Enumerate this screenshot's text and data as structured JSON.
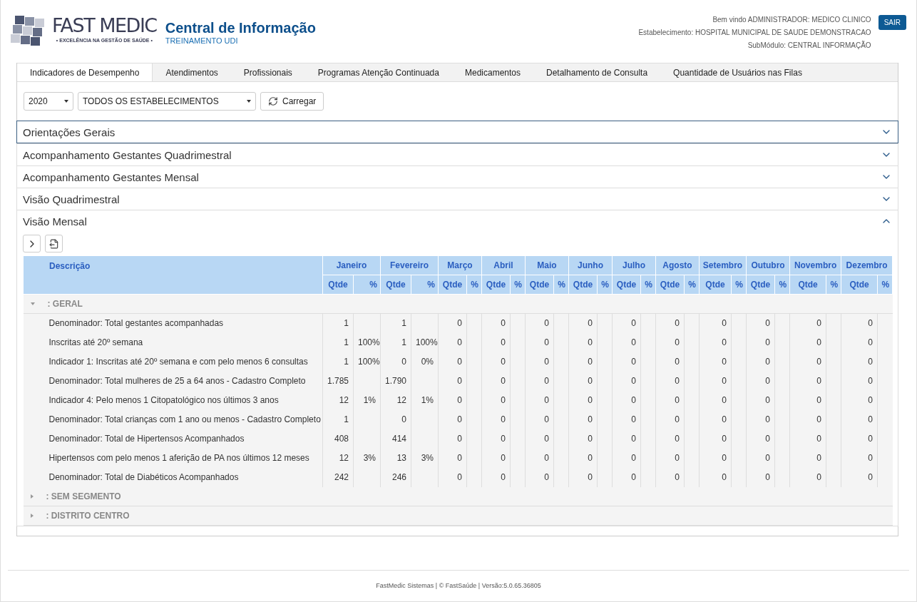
{
  "logo": {
    "brand": "FAST MEDIC",
    "tagline": "• EXCELÊNCIA NA GESTÃO DE SAÚDE •"
  },
  "header": {
    "title": "Central de Informação",
    "subtitle": "TREINAMENTO UDI",
    "user_lines": [
      "Bem vindo ADMINISTRADOR: MEDICO CLINICO",
      "Estabelecimento: HOSPITAL MUNICIPAL DE SAUDE DEMONSTRACAO",
      "SubMódulo: CENTRAL INFORMAÇÃO"
    ],
    "logout": "SAIR"
  },
  "tabs": [
    {
      "label": "Indicadores de Desempenho",
      "selected": true
    },
    {
      "label": "Atendimentos",
      "selected": false
    },
    {
      "label": "Profissionais",
      "selected": false
    },
    {
      "label": "Programas Atenção Continuada",
      "selected": false
    },
    {
      "label": "Medicamentos",
      "selected": false
    },
    {
      "label": "Detalhamento de Consulta",
      "selected": false
    },
    {
      "label": "Quantidade de Usuários nas Filas",
      "selected": false
    }
  ],
  "filters": {
    "year": "2020",
    "establishment": "TODOS OS ESTABELECIMENTOS",
    "load_button": "Carregar"
  },
  "sections": [
    {
      "title": "Orientações Gerais",
      "expanded": false,
      "focused": true
    },
    {
      "title": "Acompanhamento Gestantes Quadrimestral",
      "expanded": false,
      "focused": false
    },
    {
      "title": "Acompanhamento Gestantes Mensal",
      "expanded": false,
      "focused": false
    },
    {
      "title": "Visão Quadrimestral",
      "expanded": false,
      "focused": false
    },
    {
      "title": "Visão Mensal",
      "expanded": true,
      "focused": false
    }
  ],
  "table": {
    "description_header": "Descrição",
    "months": [
      {
        "label": "Janeiro",
        "sub": [
          "Qtde",
          "%"
        ]
      },
      {
        "label": "Fevereiro",
        "sub": [
          "Qtde",
          "%"
        ]
      },
      {
        "label": "Março",
        "sub": [
          "Qtde",
          "%"
        ]
      },
      {
        "label": "Abril",
        "sub": [
          "Qtde",
          "%"
        ]
      },
      {
        "label": "Maio",
        "sub": [
          "Qtde",
          "%"
        ]
      },
      {
        "label": "Junho",
        "sub": [
          "Qtde",
          "%"
        ]
      },
      {
        "label": "Julho",
        "sub": [
          "Qtde",
          "%"
        ]
      },
      {
        "label": "Agosto",
        "sub": [
          "Qtde",
          "%"
        ]
      },
      {
        "label": "Setembro",
        "sub": [
          "Qtde",
          "%"
        ]
      },
      {
        "label": "Outubro",
        "sub": [
          "Qtde",
          "%"
        ]
      },
      {
        "label": "Novembro",
        "sub": [
          "Qtde",
          "%"
        ]
      },
      {
        "label": "Dezembro",
        "sub": [
          "Qtde",
          "%"
        ]
      }
    ],
    "groups": [
      {
        "label": ": GERAL",
        "expanded": true,
        "rows": [
          {
            "description": "Denominador: Total gestantes acompanhadas",
            "values": [
              [
                "1"
              ],
              [
                "1"
              ],
              [
                "0"
              ],
              [
                "0"
              ],
              [
                "0"
              ],
              [
                "0"
              ],
              [
                "0"
              ],
              [
                "0"
              ],
              [
                "0"
              ],
              [
                "0"
              ],
              [
                "0"
              ],
              [
                "0"
              ]
            ]
          },
          {
            "description": "Inscritas até 20º semana",
            "values": [
              [
                "1",
                "100%"
              ],
              [
                "1",
                "100%"
              ],
              [
                "0"
              ],
              [
                "0"
              ],
              [
                "0"
              ],
              [
                "0"
              ],
              [
                "0"
              ],
              [
                "0"
              ],
              [
                "0"
              ],
              [
                "0"
              ],
              [
                "0"
              ],
              [
                "0"
              ]
            ]
          },
          {
            "description": "Indicador 1: Inscritas até 20º semana e com pelo menos 6 consultas",
            "values": [
              [
                "1",
                "100%"
              ],
              [
                "0",
                "0%"
              ],
              [
                "0"
              ],
              [
                "0"
              ],
              [
                "0"
              ],
              [
                "0"
              ],
              [
                "0"
              ],
              [
                "0"
              ],
              [
                "0"
              ],
              [
                "0"
              ],
              [
                "0"
              ],
              [
                "0"
              ]
            ]
          },
          {
            "description": "Denominador: Total mulheres de 25 a 64 anos - Cadastro Completo",
            "values": [
              [
                "1.785"
              ],
              [
                "1.790"
              ],
              [
                "0"
              ],
              [
                "0"
              ],
              [
                "0"
              ],
              [
                "0"
              ],
              [
                "0"
              ],
              [
                "0"
              ],
              [
                "0"
              ],
              [
                "0"
              ],
              [
                "0"
              ],
              [
                "0"
              ]
            ]
          },
          {
            "description": "Indicador 4: Pelo menos 1 Citopatológico nos últimos 3 anos",
            "values": [
              [
                "12",
                "1%"
              ],
              [
                "12",
                "1%"
              ],
              [
                "0"
              ],
              [
                "0"
              ],
              [
                "0"
              ],
              [
                "0"
              ],
              [
                "0"
              ],
              [
                "0"
              ],
              [
                "0"
              ],
              [
                "0"
              ],
              [
                "0"
              ],
              [
                "0"
              ]
            ]
          },
          {
            "description": "Denominador: Total crianças com 1 ano ou menos - Cadastro Completo",
            "values": [
              [
                "1"
              ],
              [
                "0"
              ],
              [
                "0"
              ],
              [
                "0"
              ],
              [
                "0"
              ],
              [
                "0"
              ],
              [
                "0"
              ],
              [
                "0"
              ],
              [
                "0"
              ],
              [
                "0"
              ],
              [
                "0"
              ],
              [
                "0"
              ]
            ]
          },
          {
            "description": "Denominador: Total de Hipertensos Acompanhados",
            "values": [
              [
                "408"
              ],
              [
                "414"
              ],
              [
                "0"
              ],
              [
                "0"
              ],
              [
                "0"
              ],
              [
                "0"
              ],
              [
                "0"
              ],
              [
                "0"
              ],
              [
                "0"
              ],
              [
                "0"
              ],
              [
                "0"
              ],
              [
                "0"
              ]
            ]
          },
          {
            "description": "Hipertensos com pelo menos 1 aferição de PA nos últimos 12 meses",
            "values": [
              [
                "12",
                "3%"
              ],
              [
                "13",
                "3%"
              ],
              [
                "0"
              ],
              [
                "0"
              ],
              [
                "0"
              ],
              [
                "0"
              ],
              [
                "0"
              ],
              [
                "0"
              ],
              [
                "0"
              ],
              [
                "0"
              ],
              [
                "0"
              ],
              [
                "0"
              ]
            ]
          },
          {
            "description": "Denominador: Total de Diabéticos Acompanhados",
            "values": [
              [
                "242"
              ],
              [
                "246"
              ],
              [
                "0"
              ],
              [
                "0"
              ],
              [
                "0"
              ],
              [
                "0"
              ],
              [
                "0"
              ],
              [
                "0"
              ],
              [
                "0"
              ],
              [
                "0"
              ],
              [
                "0"
              ],
              [
                "0"
              ]
            ]
          }
        ]
      },
      {
        "label": ": SEM SEGMENTO",
        "expanded": false
      },
      {
        "label": ": DISTRITO CENTRO",
        "expanded": false
      }
    ]
  },
  "footer": "FastMedic Sistemas | © FastSaúde | Versão:5.0.65.36805"
}
